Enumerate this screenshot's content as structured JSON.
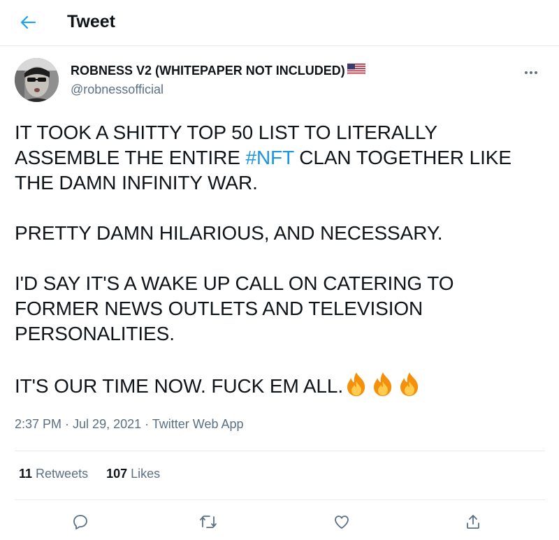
{
  "header": {
    "title": "Tweet",
    "back_icon": "arrow-left-icon",
    "accent": "#1da1f2"
  },
  "author": {
    "name": "ROBNESS V2 (WHITEPAPER NOT INCLUDED)",
    "flag_icon": "us-flag-icon",
    "handle": "@robnessofficial"
  },
  "tweet": {
    "line1_pre": "IT TOOK A SHITTY TOP 50 LIST TO LITERALLY",
    "line2_pre": "ASSEMBLE THE ENTIRE ",
    "hashtag": "#NFT",
    "line2_post": " CLAN TOGETHER LIKE",
    "line3": "THE DAMN INFINITY WAR.",
    "para2": "PRETTY DAMN HILARIOUS, AND NECESSARY.",
    "para3_line1": "I'D SAY IT'S A WAKE UP CALL ON CATERING TO",
    "para3_line2": "FORMER NEWS OUTLETS AND TELEVISION",
    "para3_line3": "PERSONALITIES.",
    "para4": "IT'S OUR TIME NOW. FUCK EM ALL.",
    "emoji_icon": "fire-icon",
    "emoji_count": 3,
    "hashtag_color": "#1b95e0"
  },
  "meta": {
    "time": "2:37 PM",
    "sep1": " · ",
    "date": "Jul 29, 2021",
    "sep2": " · ",
    "source": "Twitter Web App"
  },
  "stats": {
    "retweets_count": "11",
    "retweets_label": "Retweets",
    "likes_count": "107",
    "likes_label": "Likes"
  },
  "actions": {
    "reply_icon": "reply-icon",
    "retweet_icon": "retweet-icon",
    "like_icon": "heart-icon",
    "share_icon": "share-icon"
  },
  "colors": {
    "text": "#0f1419",
    "secondary": "#5b7083",
    "border": "#e6ecf0",
    "accent": "#1da1f2"
  }
}
